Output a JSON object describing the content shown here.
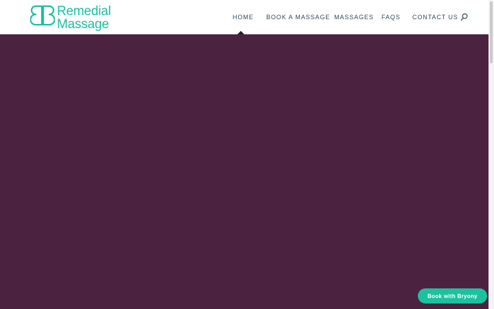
{
  "brand": {
    "line1": "Remedial",
    "line2": "Massage",
    "color": "#1bbfa3"
  },
  "nav": {
    "items": [
      {
        "label": "HOME",
        "active": true
      },
      {
        "label": "BOOK A MASSAGE",
        "active": false
      },
      {
        "label": "MASSAGES",
        "active": false
      },
      {
        "label": "FAQS",
        "active": false
      },
      {
        "label": "CONTACT US",
        "active": false
      }
    ],
    "search_icon": "search-icon"
  },
  "hero": {
    "background_color": "#4b2341"
  },
  "cta": {
    "label": "Book with Bryony",
    "color": "#1cc2a0"
  }
}
